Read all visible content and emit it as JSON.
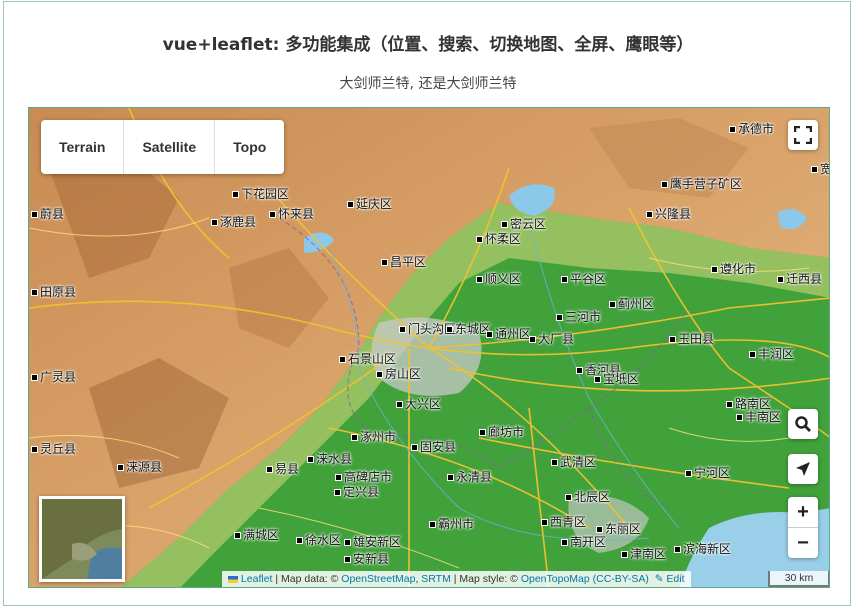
{
  "header": {
    "title": "vue+leaflet: 多功能集成（位置、搜索、切换地图、全屏、鹰眼等）",
    "subtitle": "大剑师兰特, 还是大剑师兰特"
  },
  "layers": {
    "terrain": "Terrain",
    "satellite": "Satellite",
    "topo": "Topo"
  },
  "controls": {
    "fullscreen_icon": "fullscreen-icon",
    "search_icon": "search-icon",
    "locate_icon": "locate-arrow-icon",
    "zoom_in": "+",
    "zoom_out": "−"
  },
  "attribution": {
    "leaflet": "Leaflet",
    "map_data_prefix": " | Map data: © ",
    "osm": "OpenStreetMap",
    "sep": ", ",
    "srtm": "SRTM",
    "style_prefix": " | Map style: © ",
    "opentopomap": "OpenTopoMap",
    "license": " (CC-BY-SA)",
    "edit": "✎ Edit"
  },
  "scale": "30 km",
  "places": [
    "承德市",
    "宽",
    "鹰手营子矿区",
    "兴隆县",
    "遵化市",
    "迁西县",
    "下花园区",
    "延庆区",
    "怀来县",
    "涿鹿县",
    "密云区",
    "怀柔区",
    "昌平区",
    "顺义区",
    "平谷区",
    "蓟州区",
    "门头沟区",
    "东城区",
    "通州区",
    "三河市",
    "玉田县",
    "丰润区",
    "石景山区",
    "大厂县",
    "香河县",
    "宝坻区",
    "房山区",
    "大兴区",
    "路南区",
    "丰南区",
    "涿州市",
    "固安县",
    "廊坊市",
    "武清区",
    "宁河区",
    "易县",
    "涞水县",
    "高碑店市",
    "永清县",
    "定兴县",
    "北辰区",
    "满城区",
    "徐水区",
    "雄安新区",
    "霸州市",
    "西青区",
    "东丽区",
    "滨海新区",
    "南开区",
    "津南区",
    "安新县",
    "蔚县",
    "涞源县",
    "广灵县",
    "灵丘县",
    "田原县"
  ]
}
